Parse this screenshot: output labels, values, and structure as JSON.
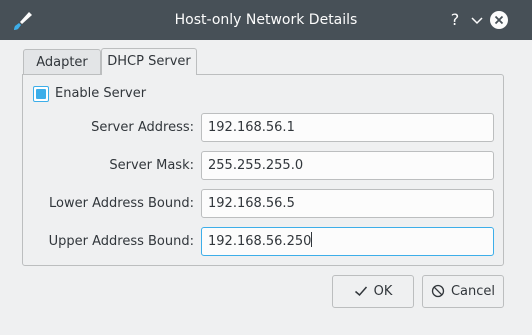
{
  "window": {
    "title": "Host-only Network Details",
    "help_glyph": "?",
    "minimize_glyph": "⌄",
    "icons": [
      "app-brush-icon",
      "help-icon",
      "minimize-icon",
      "close-icon"
    ]
  },
  "tabs": [
    {
      "label": "Adapter",
      "selected": false
    },
    {
      "label": "DHCP Server",
      "selected": true
    }
  ],
  "dhcp": {
    "enable_label": "Enable Server",
    "enabled": true,
    "fields": [
      {
        "label": "Server Address:",
        "value": "192.168.56.1"
      },
      {
        "label": "Server Mask:",
        "value": "255.255.255.0"
      },
      {
        "label": "Lower Address Bound:",
        "value": "192.168.56.5"
      },
      {
        "label": "Upper Address Bound:",
        "value": "192.168.56.250"
      }
    ]
  },
  "buttons": {
    "ok_label": "OK",
    "cancel_label": "Cancel",
    "ok_icon": "checkmark-icon",
    "cancel_icon": "cancel-icon"
  },
  "colors": {
    "titlebar": "#475057",
    "accent": "#3daee9",
    "background": "#eff0f1"
  }
}
